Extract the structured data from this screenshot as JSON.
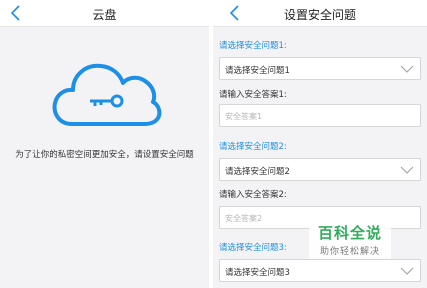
{
  "left_screen": {
    "title": "云盘",
    "message": "为了让你的私密空间更加安全，请设置安全问题"
  },
  "right_screen": {
    "title": "设置安全问题",
    "questions": [
      {
        "label": "请选择安全问题1:",
        "selected": "请选择安全问题1",
        "answer_label": "请输入安全答案1:",
        "answer_placeholder": "安全答案1"
      },
      {
        "label": "请选择安全问题2:",
        "selected": "请选择安全问题2",
        "answer_label": "请输入安全答案2:",
        "answer_placeholder": "安全答案2"
      },
      {
        "label": "请选择安全问题3:",
        "selected": "请选择安全问题3"
      }
    ]
  },
  "watermark": {
    "title": "百科全说",
    "subtitle": "助你轻松解决"
  },
  "colors": {
    "accent": "#1c8fe6",
    "background": "#f3f3f5",
    "watermark_green": "#34ac5e"
  },
  "icons": [
    "back-arrow-icon",
    "cloud-key-icon",
    "chevron-down-icon"
  ]
}
